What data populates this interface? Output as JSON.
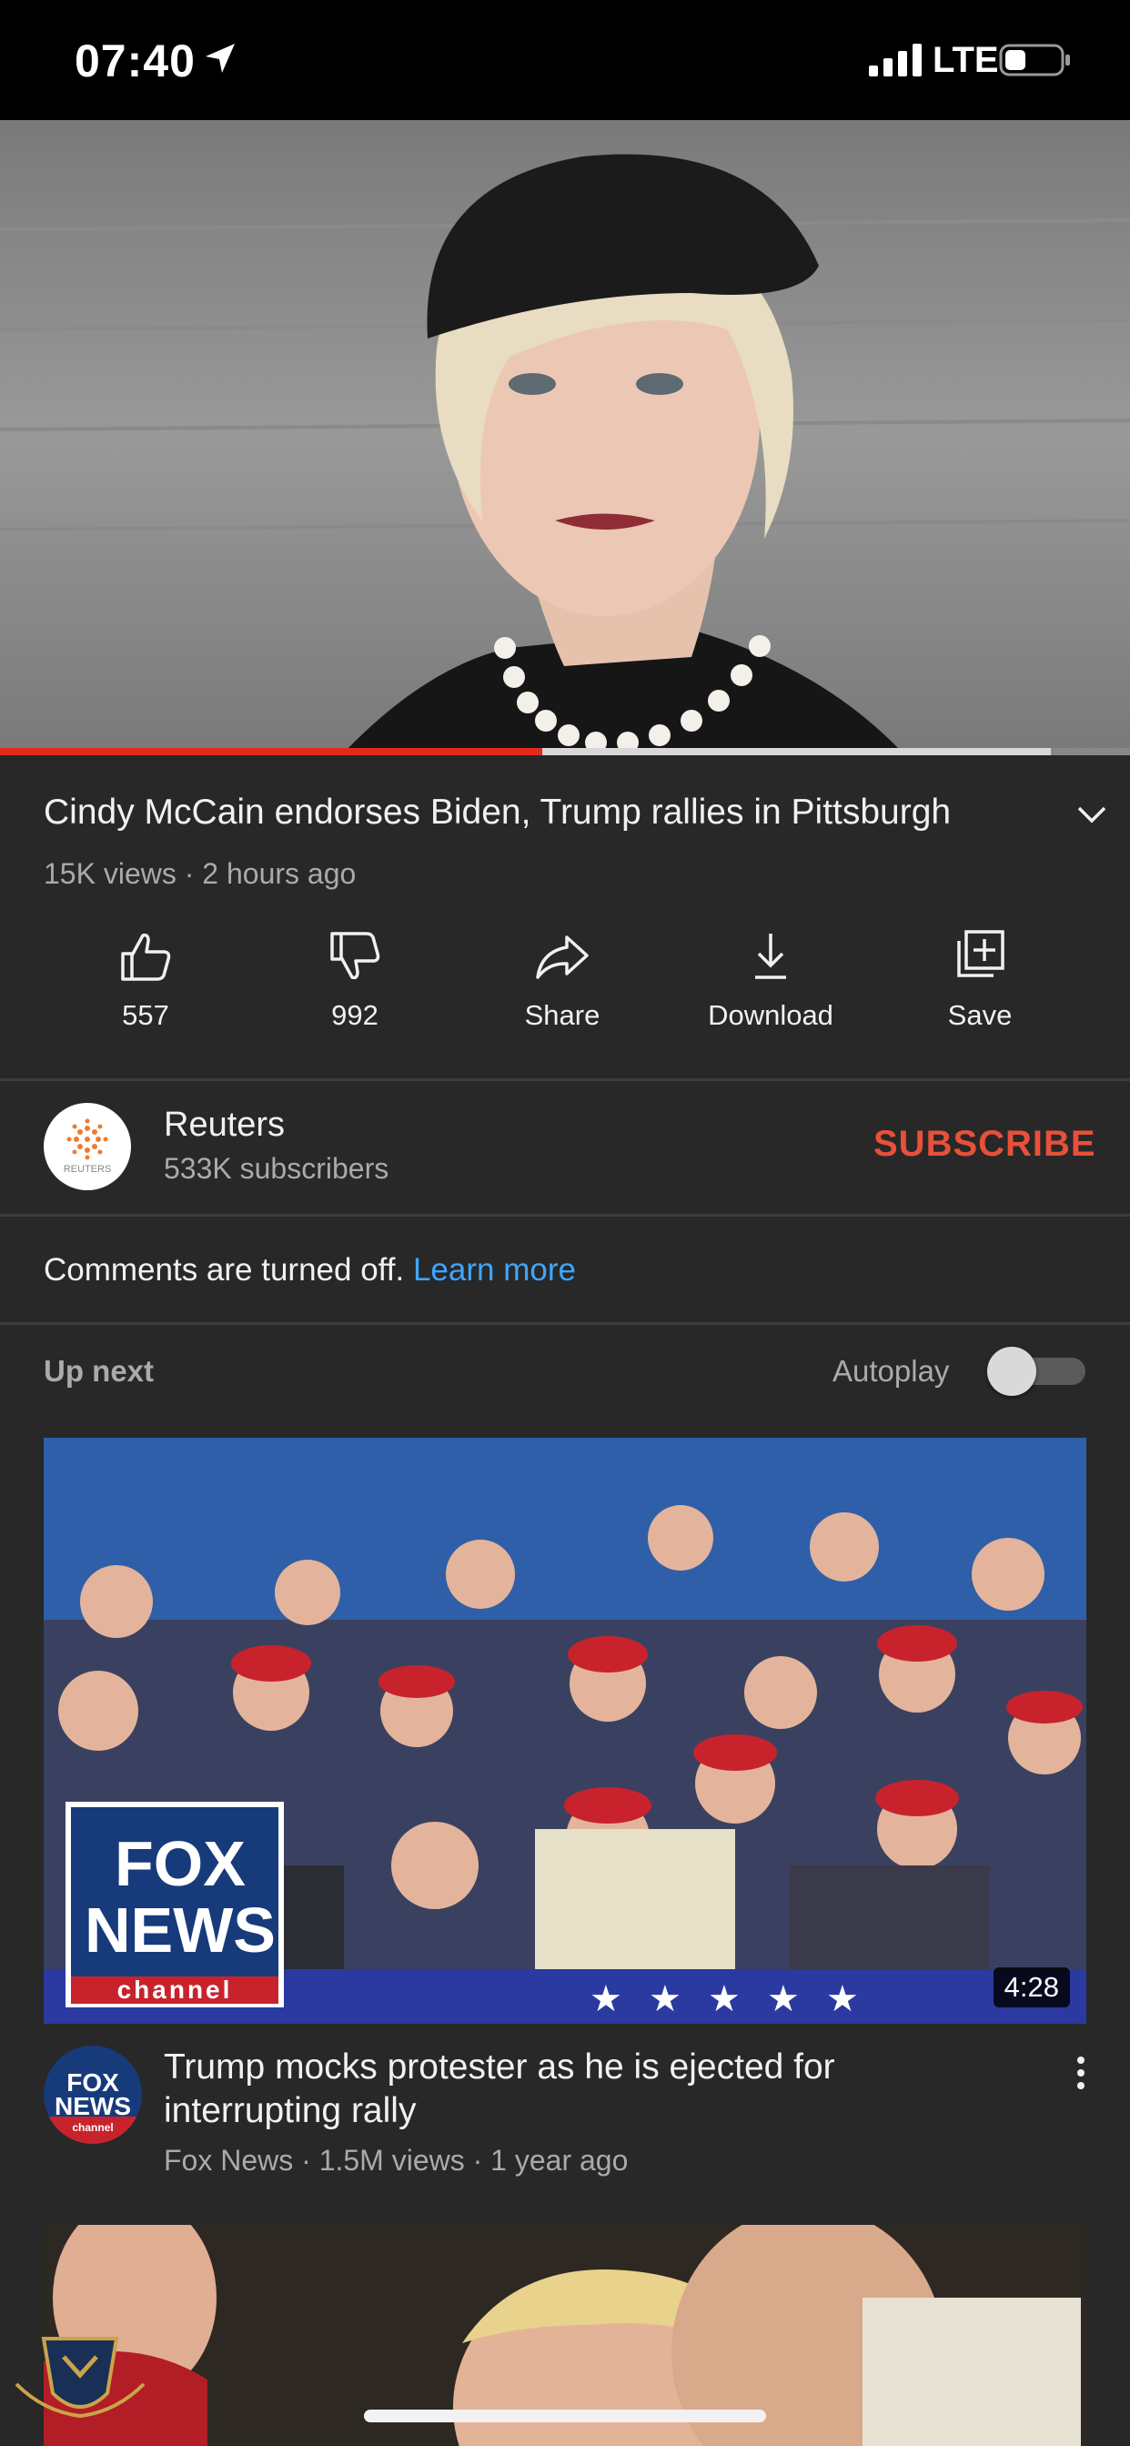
{
  "status_bar": {
    "time": "07:40",
    "network": "LTE",
    "icons": [
      "location-arrow-icon",
      "signal-bars-icon",
      "battery-icon"
    ]
  },
  "player": {
    "progress": 0.48,
    "buffered": 0.93,
    "accent_color": "#e32b1c"
  },
  "video": {
    "title": "Cindy McCain endorses Biden, Trump rallies in Pittsburgh",
    "meta": "15K views · 2 hours ago"
  },
  "actions": [
    {
      "label": "557",
      "icon": "thumbs-up-icon"
    },
    {
      "label": "992",
      "icon": "thumbs-down-icon"
    },
    {
      "label": "Share",
      "icon": "share-arrow-icon"
    },
    {
      "label": "Download",
      "icon": "download-icon"
    },
    {
      "label": "Save",
      "icon": "add-to-playlist-icon"
    }
  ],
  "channel": {
    "name": "Reuters",
    "subscribers": "533K subscribers",
    "avatar_text": "REUTERS",
    "subscribe_label": "SUBSCRIBE",
    "subscribe_color": "#e8503a"
  },
  "comments": {
    "text": "Comments are turned off.",
    "link": "Learn more",
    "link_color": "#3ea6ff"
  },
  "up_next": {
    "label": "Up next",
    "autoplay_label": "Autoplay",
    "autoplay_on": false
  },
  "recommendations": [
    {
      "title": "Trump mocks protester as he is ejected for interrupting rally",
      "meta": "Fox News · 1.5M views · 1 year ago",
      "duration": "4:28",
      "channel_logo": {
        "line1": "FOX",
        "line2": "NEWS",
        "line3": "channel"
      }
    }
  ]
}
